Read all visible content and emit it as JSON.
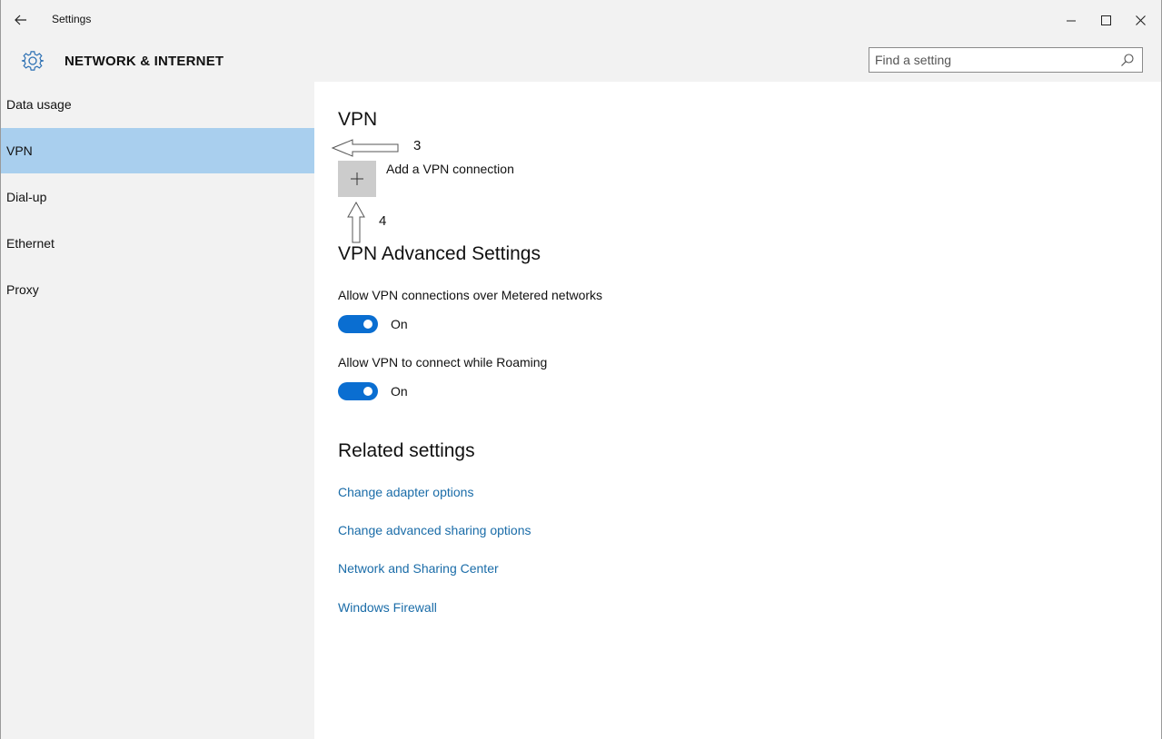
{
  "window": {
    "app_title": "Settings",
    "back_icon": "arrow-left-icon",
    "controls": [
      "minimize-icon",
      "maximize-icon",
      "close-icon"
    ]
  },
  "header": {
    "section_title": "NETWORK & INTERNET",
    "search_placeholder": "Find a setting",
    "icons": [
      "gear-icon",
      "search-icon"
    ]
  },
  "sidebar": {
    "items": [
      {
        "label": "Data usage"
      },
      {
        "label": "VPN",
        "active": true
      },
      {
        "label": "Dial-up"
      },
      {
        "label": "Ethernet"
      },
      {
        "label": "Proxy"
      }
    ]
  },
  "main": {
    "vpn_title": "VPN",
    "add_vpn_label": "Add a VPN connection",
    "annotations": [
      "3",
      "4"
    ],
    "advanced_title": "VPN Advanced Settings",
    "settings": [
      {
        "label": "Allow VPN connections over Metered networks",
        "state": "On"
      },
      {
        "label": "Allow VPN to connect while Roaming",
        "state": "On"
      }
    ],
    "related_title": "Related settings",
    "related_links": [
      "Change adapter options",
      "Change advanced sharing options",
      "Network and Sharing Center",
      "Windows Firewall"
    ]
  },
  "colors": {
    "accent": "#0a6ed1",
    "sidebar_selected": "#a9cfee",
    "link": "#1a6ca8",
    "chrome": "#f2f2f2"
  }
}
